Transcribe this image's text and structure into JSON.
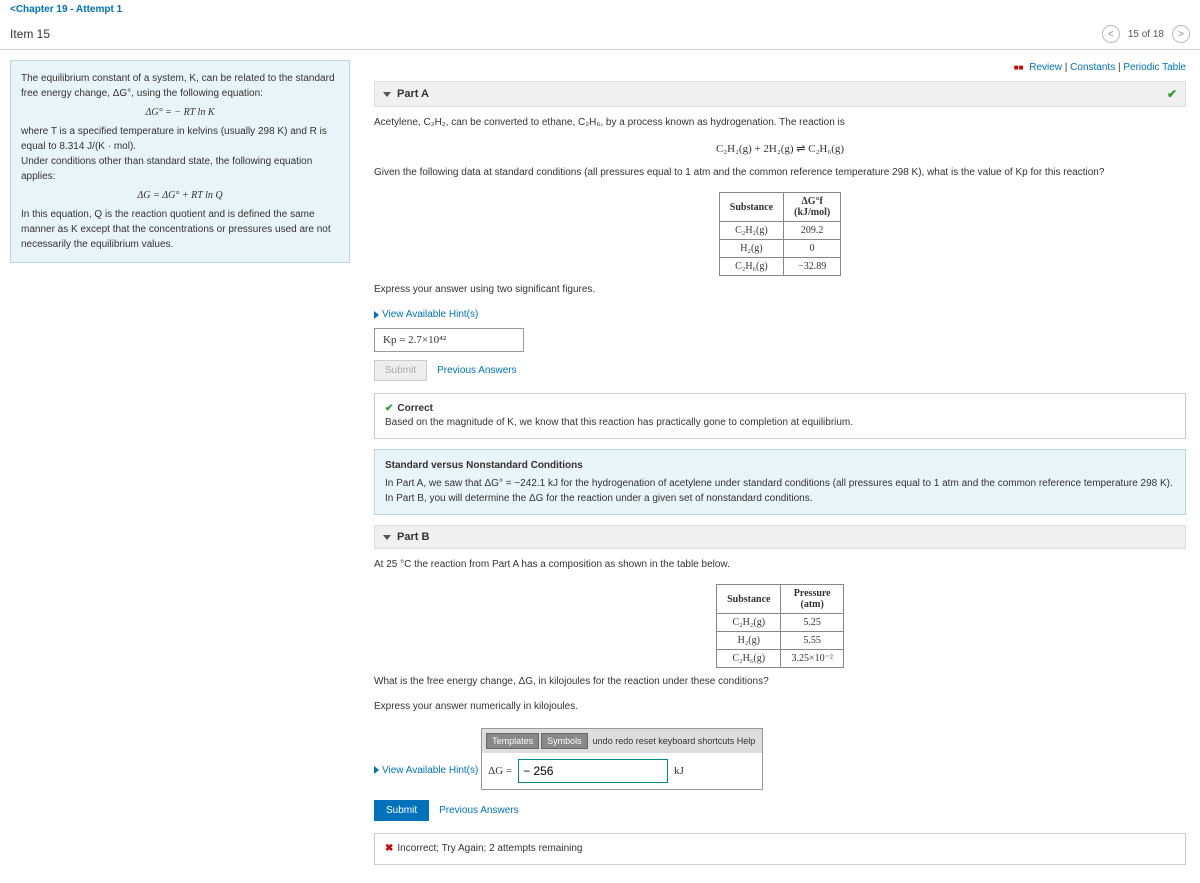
{
  "breadcrumb": "<Chapter 19 - Attempt 1",
  "item_label": "Item 15",
  "pager": "15 of 18",
  "top_links": {
    "review": "Review",
    "constants": "Constants",
    "periodic": "Periodic Table"
  },
  "sidebox": {
    "p1": "The equilibrium constant of a system, K, can be related to the standard free energy change, ΔG°, using the following equation:",
    "eq1": "ΔG° = − RT ln K",
    "p2": "where T is a specified temperature in kelvins (usually 298 K) and R is equal to 8.314 J/(K · mol).",
    "p3": "Under conditions other than standard state, the following equation applies:",
    "eq2": "ΔG = ΔG° + RT ln Q",
    "p4": "In this equation, Q is the reaction quotient and is defined the same manner as K except that the concentrations or pressures used are not necessarily the equilibrium values."
  },
  "partA": {
    "title": "Part A",
    "line1": "Acetylene, C₂H₂, can be converted to ethane, C₂H₆, by a process known as hydrogenation. The reaction is",
    "rxn": "C₂H₂(g) + 2H₂(g) ⇌ C₂H₆(g)",
    "line2": "Given the following data at standard conditions (all pressures equal to 1 atm and the common reference temperature 298 K), what is the value of Kp for this reaction?",
    "tbl_h1": "Substance",
    "tbl_h2": "ΔG°f\n(kJ/mol)",
    "r1a": "C₂H₂(g)",
    "r1b": "209.2",
    "r2a": "H₂(g)",
    "r2b": "0",
    "r3a": "C₂H₆(g)",
    "r3b": "−32.89",
    "express": "Express your answer using two significant figures.",
    "hint": "View Available Hint(s)",
    "answer": "Kp = 2.7×10⁴²",
    "submit": "Submit",
    "prev": "Previous Answers",
    "fb_title": "Correct",
    "fb_body": "Based on the magnitude of K, we know that this reaction has practically gone to completion at equilibrium."
  },
  "mid": {
    "title": "Standard versus Nonstandard Conditions",
    "body": "In Part A, we saw that ΔG° = −242.1 kJ for the hydrogenation of acetylene under standard conditions (all pressures equal to 1 atm and the common reference temperature 298 K). In Part B, you will determine the ΔG for the reaction under a given set of nonstandard conditions."
  },
  "partB": {
    "title": "Part B",
    "intro": "At 25 °C the reaction from Part A has a composition as shown in the table below.",
    "th1": "Substance",
    "th2": "Pressure\n(atm)",
    "r1a": "C₂H₂(g)",
    "r1b": "5.25",
    "r2a": "H₂(g)",
    "r2b": "5.55",
    "r3a": "C₂H₆(g)",
    "r3b": "3.25×10⁻²",
    "q": "What is the free energy change, ΔG, in kilojoules for the reaction under these conditions?",
    "express": "Express your answer numerically in kilojoules.",
    "hint": "View Available Hint(s)",
    "toolbar": {
      "templates": "Templates",
      "symbols": "Symbols",
      "rest": "undo redo reset keyboard shortcuts Help"
    },
    "lhs": "ΔG =",
    "value": "− 256",
    "unit": "kJ",
    "submit": "Submit",
    "prev": "Previous Answers",
    "fb": "Incorrect; Try Again; 2 attempts remaining"
  }
}
